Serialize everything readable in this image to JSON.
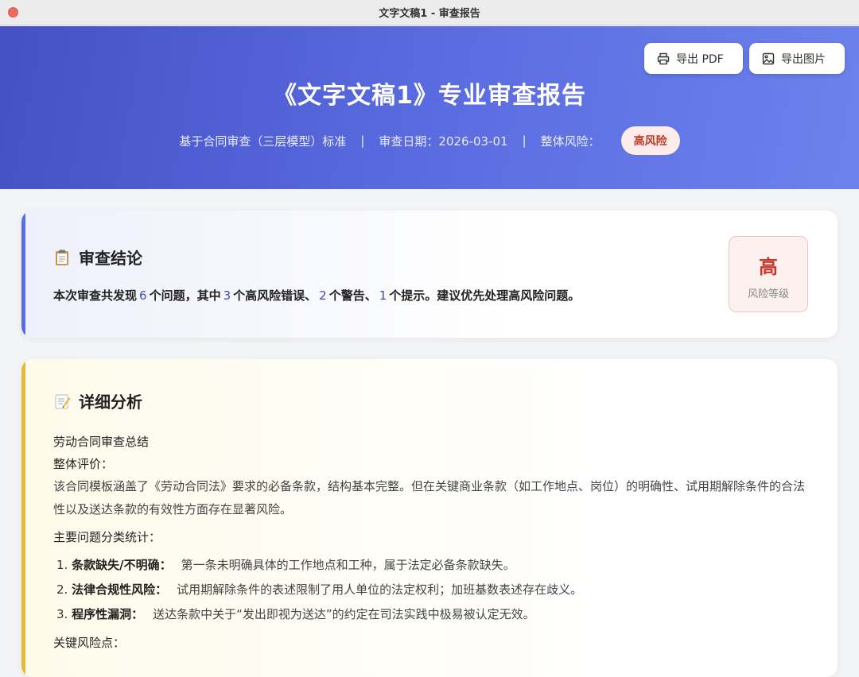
{
  "window": {
    "title": "文字文稿1 - 审查报告"
  },
  "header": {
    "title": "《文字文稿1》专业审查报告",
    "standard": "基于合同审查（三层模型）标准",
    "separator": "|",
    "date_text": "审查日期：2026-03-01",
    "risk_label": "整体风险：",
    "risk_value": "高风险",
    "export_pdf": "导出 PDF",
    "export_image": "导出图片"
  },
  "conclusion": {
    "heading": "审查结论",
    "pre1": "本次审查共发现",
    "total": "6",
    "pre2": "个问题，其中",
    "high": "3",
    "pre3": "个高风险错误、",
    "warn": "2",
    "pre4": "个警告、",
    "tip": "1",
    "pre5": "个提示。建议优先处理高风险问题。",
    "level": "高",
    "level_label": "风险等级"
  },
  "analysis": {
    "heading": "详细分析",
    "subtitle": "劳动合同审查总结",
    "overall_label": "整体评价：",
    "overall_text": "该合同模板涵盖了《劳动合同法》要求的必备条款，结构基本完整。但在关键商业条款（如工作地点、岗位）的明确性、试用期解除条件的合法性以及送达条款的有效性方面存在显著风险。",
    "stats_label": "主要问题分类统计：",
    "items": [
      {
        "num": "1.",
        "key": "条款缺失/不明确：",
        "value": "第一条未明确具体的工作地点和工种，属于法定必备条款缺失。"
      },
      {
        "num": "2.",
        "key": "法律合规性风险：",
        "value": "试用期解除条件的表述限制了用人单位的法定权利；加班基数表述存在歧义。"
      },
      {
        "num": "3.",
        "key": "程序性漏洞：",
        "value": "送达条款中关于“发出即视为送达”的约定在司法实践中极易被认定无效。"
      }
    ],
    "key_risks_label": "关键风险点："
  },
  "colors": {
    "hero_start": "#4451c4",
    "hero_end": "#6c82ec",
    "risk_red": "#c0392b",
    "accent_blue": "#5b6ee1",
    "accent_gold": "#e2b93b"
  }
}
